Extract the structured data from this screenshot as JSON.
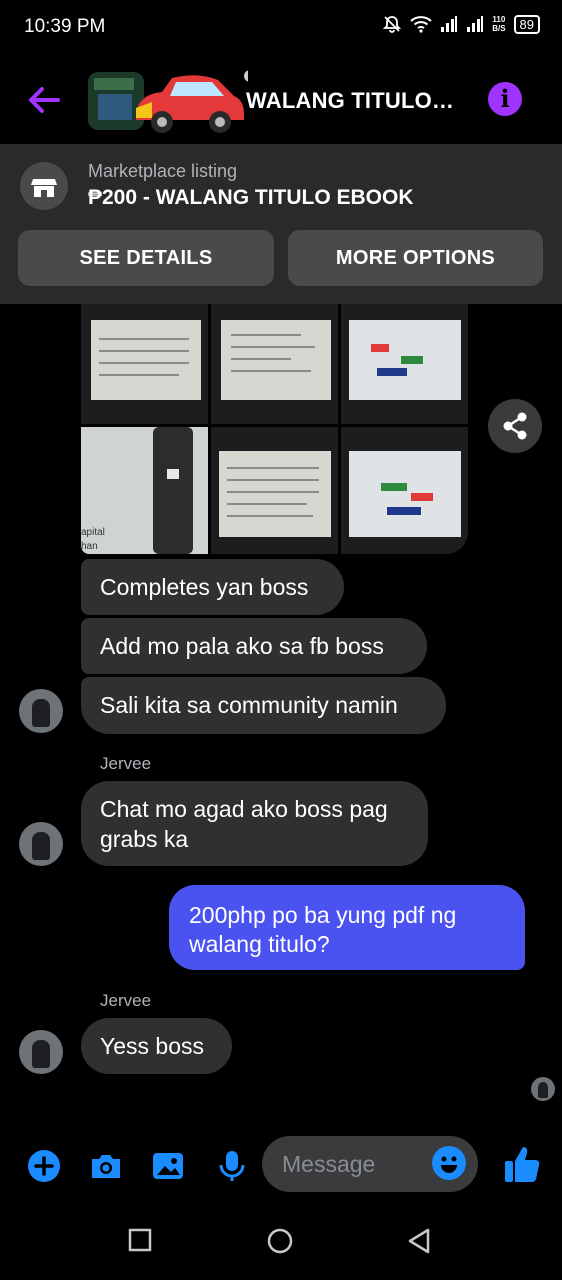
{
  "status_bar": {
    "time": "10:39 PM",
    "net_speed_top": "110",
    "net_speed_bottom": "B/S",
    "battery": "89"
  },
  "header": {
    "title": "WALANG TITULO…",
    "accent": "#a033ff"
  },
  "marketplace": {
    "label": "Marketplace listing",
    "title": "₱200 - WALANG TITULO EBOOK",
    "see_details": "SEE DETAILS",
    "more_options": "MORE OPTIONS"
  },
  "messages": [
    {
      "text": "Completes yan boss"
    },
    {
      "text": "Add mo pala ako sa fb boss"
    },
    {
      "text": "Sali kita sa community namin"
    },
    {
      "sender": "Jervee",
      "text": "Chat mo agad ako boss pag grabs ka"
    },
    {
      "text": "200php po ba yung pdf ng walang titulo?",
      "outgoing": true
    },
    {
      "sender": "Jervee",
      "text": "Yess boss"
    }
  ],
  "photo_text": {
    "side_1": "apital",
    "side_2": "han"
  },
  "composer": {
    "placeholder": "Message",
    "accent": "#1a8cff"
  }
}
